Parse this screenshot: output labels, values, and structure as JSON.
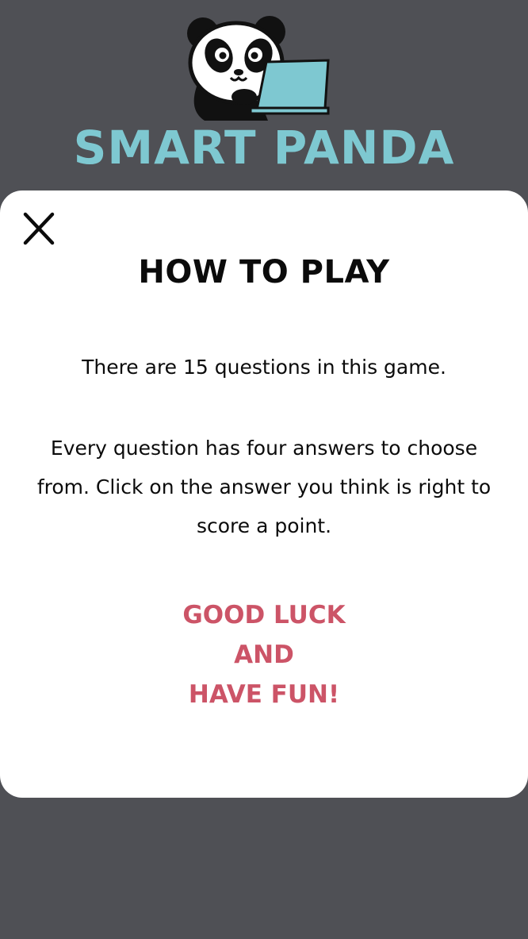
{
  "app": {
    "title": "SMART PANDA",
    "logo_icon": "panda-with-laptop-icon"
  },
  "modal": {
    "close_icon": "close-icon",
    "title": "HOW TO PLAY",
    "paragraph_1": "There are 15 questions in this game.",
    "paragraph_2": "Every question has four answers to choose from. Click on the answer you think is right to score a point.",
    "closing_lines": [
      "GOOD LUCK",
      "AND",
      "HAVE FUN!"
    ]
  },
  "colors": {
    "background": "#4f5055",
    "brand_teal": "#7ec8d1",
    "accent_pink": "#cc5467",
    "modal_bg": "#ffffff",
    "text": "#0b0b0b"
  }
}
